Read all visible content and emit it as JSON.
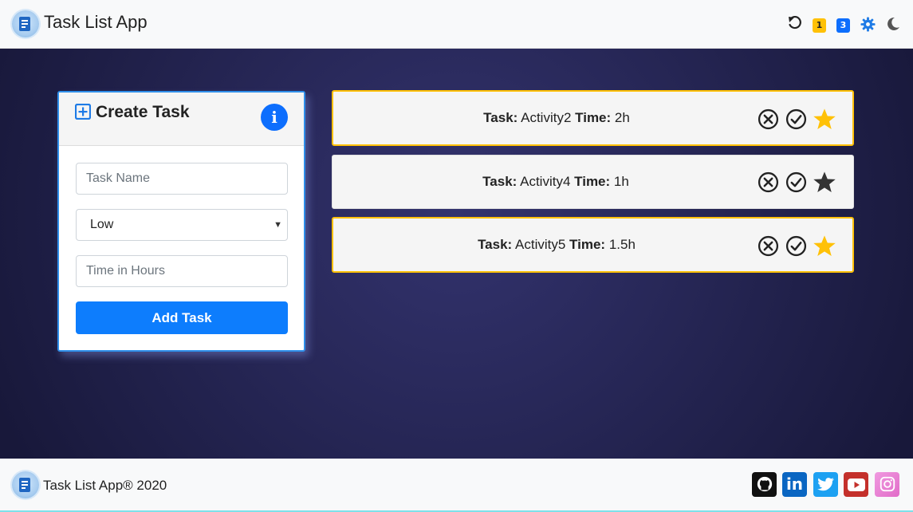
{
  "header": {
    "title": "Task List App",
    "icons": [
      "logo-icon",
      "undo-icon",
      "settings-icon",
      "dark-mode-icon"
    ],
    "badges": [
      "1",
      "3"
    ]
  },
  "create_task": {
    "title": "Create Task",
    "task_name_placeholder": "Task Name",
    "priority_selected": "Low",
    "time_placeholder": "Time in Hours",
    "add_button": "Add Task"
  },
  "tasks": [
    {
      "task_label": "Task:",
      "name": "Activity2",
      "time_label": "Time:",
      "time": "2h",
      "starred": true
    },
    {
      "task_label": "Task:",
      "name": "Activity4",
      "time_label": "Time:",
      "time": "1h",
      "starred": false
    },
    {
      "task_label": "Task:",
      "name": "Activity5",
      "time_label": "Time:",
      "time": "1.5h",
      "starred": true
    }
  ],
  "footer": {
    "copyright": "Task List App® 2020",
    "social": [
      "github-icon",
      "linkedin-icon",
      "twitter-icon",
      "youtube-icon",
      "instagram-icon"
    ]
  },
  "colors": {
    "accent": "#0d6efd",
    "star_active": "#ffc107",
    "star_inactive": "#333333",
    "background_dark": "#272757"
  }
}
